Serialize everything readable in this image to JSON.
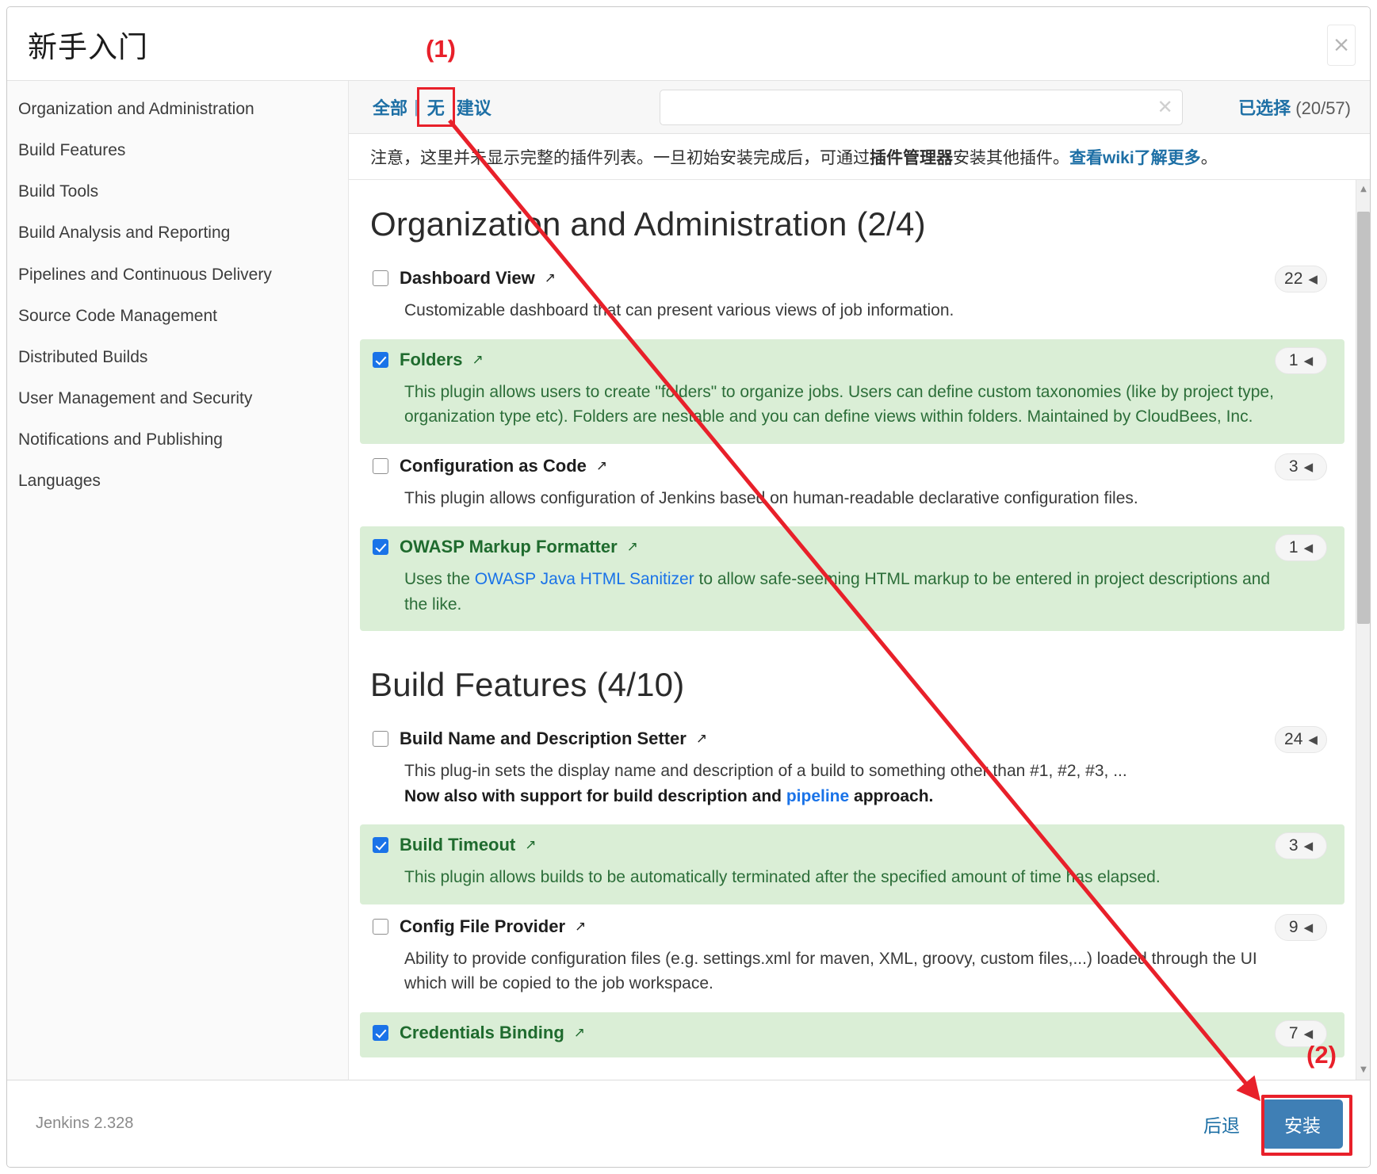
{
  "dialog": {
    "title": "新手入门",
    "close_label": "×"
  },
  "sidebar": {
    "items": [
      {
        "label": "Organization and Administration"
      },
      {
        "label": "Build Features"
      },
      {
        "label": "Build Tools"
      },
      {
        "label": "Build Analysis and Reporting"
      },
      {
        "label": "Pipelines and Continuous Delivery"
      },
      {
        "label": "Source Code Management"
      },
      {
        "label": "Distributed Builds"
      },
      {
        "label": "User Management and Security"
      },
      {
        "label": "Notifications and Publishing"
      },
      {
        "label": "Languages"
      }
    ]
  },
  "filterbar": {
    "tab_all": "全部",
    "tab_separator": "|",
    "tab_none": "无",
    "tab_suggested": "建议",
    "search_value": "",
    "search_placeholder": "",
    "search_clear_icon": "✕",
    "selected_label": "已选择",
    "selected_count": "(20/57)"
  },
  "notice": {
    "part1": "注意，这里并未显示完整的插件列表。一旦初始安装完成后，可通过",
    "bold1": "插件管理器",
    "part2": "安装其他插件。",
    "link": "查看wiki了解更多",
    "part3": "。"
  },
  "groups": [
    {
      "title": "Organization and Administration (2/4)",
      "plugins": [
        {
          "name": "Dashboard View",
          "checked": false,
          "deps": "22",
          "desc_html": "Customizable dashboard that can present various views of job information."
        },
        {
          "name": "Folders",
          "checked": true,
          "deps": "1",
          "desc_html": "This plugin allows users to create \"folders\" to organize jobs. Users can define custom taxonomies (like by project type, organization type etc). Folders are nestable and you can define views within folders. Maintained by CloudBees, Inc."
        },
        {
          "name": "Configuration as Code",
          "checked": false,
          "deps": "3",
          "desc_html": "This plugin allows configuration of Jenkins based on human-readable declarative configuration files."
        },
        {
          "name": "OWASP Markup Formatter",
          "checked": true,
          "deps": "1",
          "desc_html": "Uses the <a href=\"#\">OWASP Java HTML Sanitizer</a> to allow safe-seeming HTML markup to be entered in project descriptions and the like."
        }
      ]
    },
    {
      "title": "Build Features (4/10)",
      "plugins": [
        {
          "name": "Build Name and Description Setter",
          "checked": false,
          "deps": "24",
          "desc_html": "This plug-in sets the display name and description of a build to something other than #1, #2, #3, ...<br><b>Now also with support for build description and <a href=\"#\">pipeline</a> approach.</b>"
        },
        {
          "name": "Build Timeout",
          "checked": true,
          "deps": "3",
          "desc_html": "This plugin allows builds to be automatically terminated after the specified amount of time has elapsed."
        },
        {
          "name": "Config File Provider",
          "checked": false,
          "deps": "9",
          "desc_html": "Ability to provide configuration files (e.g. settings.xml for maven, XML, groovy, custom files,...) loaded through the UI which will be copied to the job workspace."
        },
        {
          "name": "Credentials Binding",
          "checked": true,
          "deps": "7",
          "desc_html": ""
        }
      ]
    }
  ],
  "footer": {
    "version": "Jenkins 2.328",
    "back_label": "后退",
    "install_label": "安装"
  },
  "annotations": {
    "step1": "(1)",
    "step2": "(2)",
    "highlight_color": "#e8202a"
  },
  "icons": {
    "external_link": "↗",
    "caret_left": "◀",
    "scroll_up": "▲",
    "scroll_down": "▼"
  }
}
